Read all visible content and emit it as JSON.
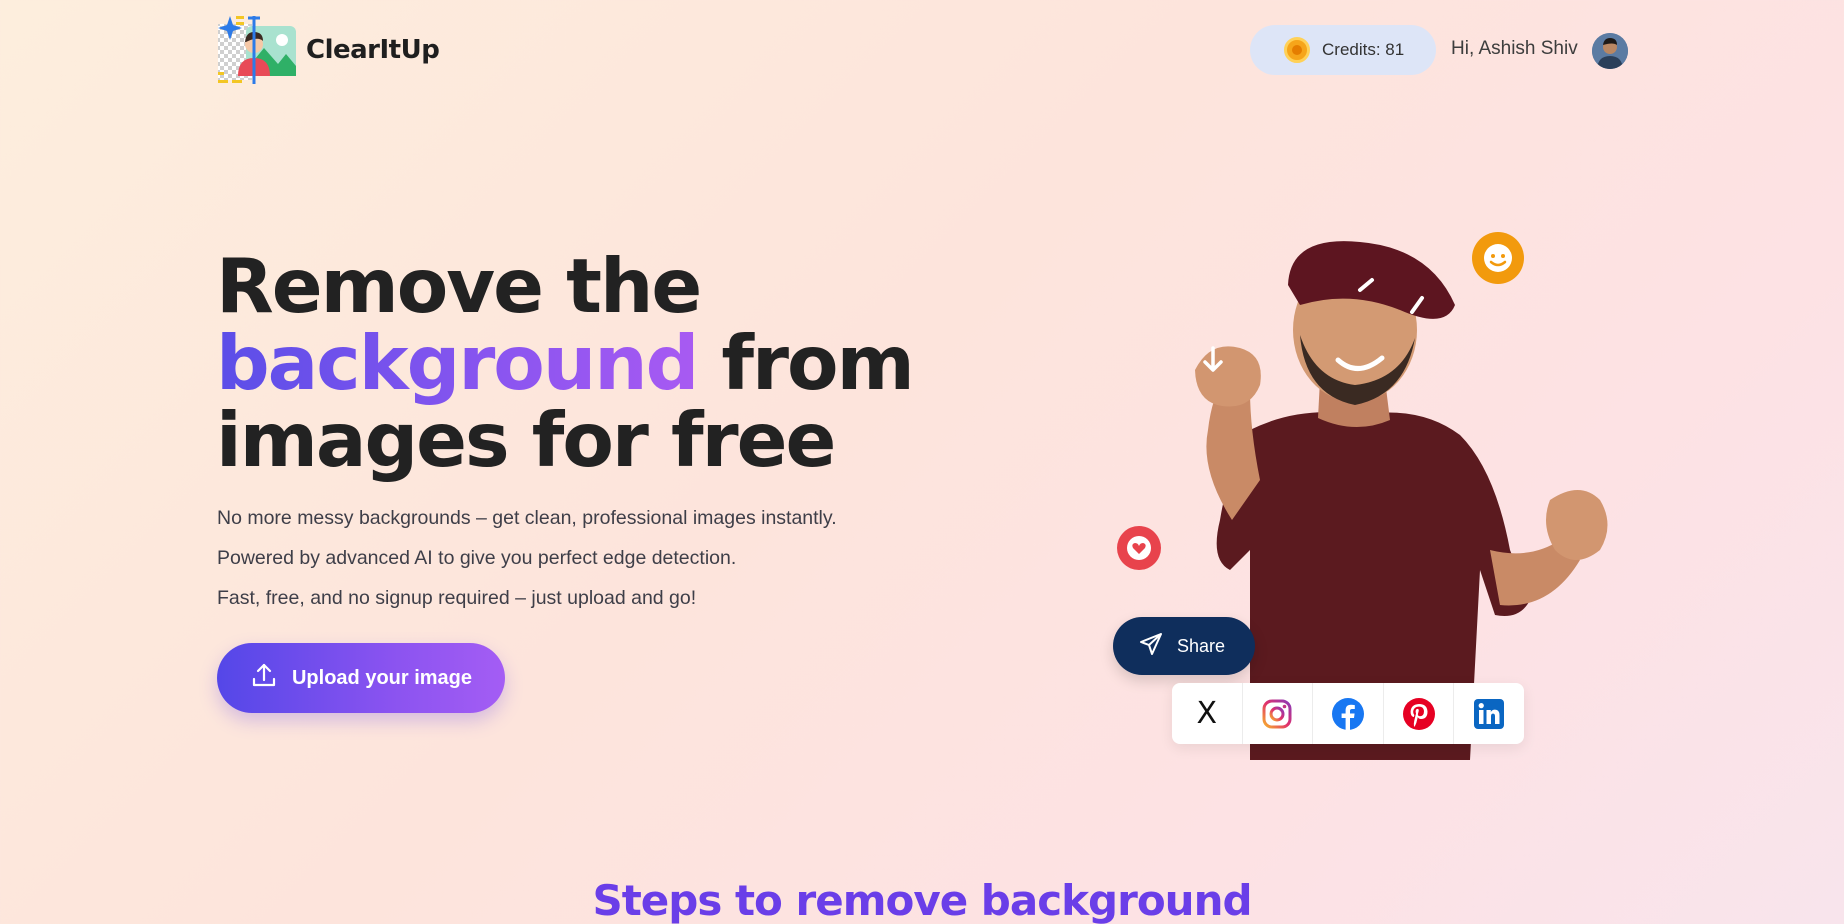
{
  "brand": {
    "name": "ClearItUp"
  },
  "header": {
    "credits_label": "Credits: 81",
    "greeting": "Hi, Ashish Shiv"
  },
  "hero": {
    "title_line1": "Remove the",
    "title_accent": "background",
    "title_line2_rest": " from",
    "title_line3": "images for free",
    "desc1": "No more messy backgrounds – get clean, professional images instantly.",
    "desc2": "Powered by advanced AI to give you perfect edge detection.",
    "desc3": "Fast, free, and no signup required – just upload and go!",
    "upload_label": "Upload your image"
  },
  "share": {
    "label": "Share",
    "x_glyph": "X",
    "socials": [
      "x-icon",
      "instagram-icon",
      "facebook-icon",
      "pinterest-icon",
      "linkedin-icon"
    ]
  },
  "steps": {
    "title": "Steps to remove background"
  },
  "colors": {
    "accent_start": "#5447e8",
    "accent_end": "#a45df4",
    "share_bg": "#0f2e5c",
    "credits_bg": "#dde5f7",
    "steps_title": "#6a3ee8"
  }
}
